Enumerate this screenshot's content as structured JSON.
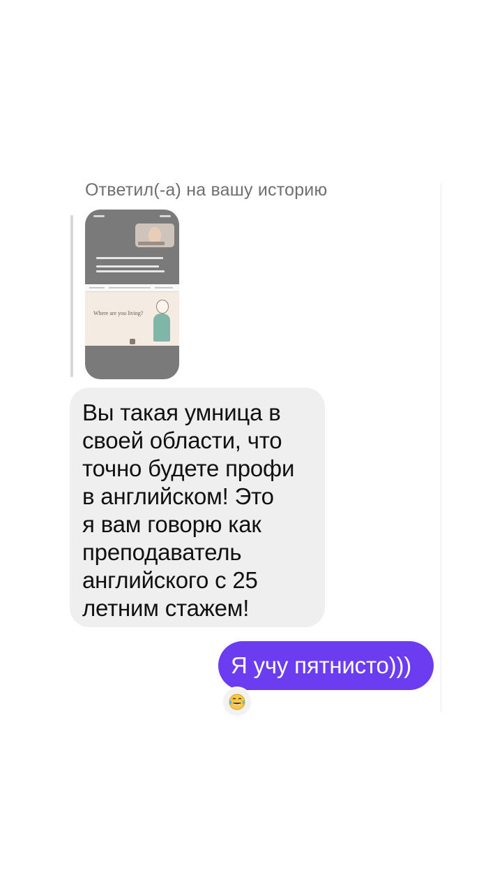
{
  "story_reply": {
    "header": "Ответил(-а) на вашу историю",
    "thumbnail": {
      "slide_text": "Where are you living?"
    }
  },
  "messages": [
    {
      "direction": "incoming",
      "text": "Вы такая умница в\nсвоей области, что\nточно будете профи\nв английском! Это\nя вам говорю как\nпреподаватель\nанглийского с 25\nлетним стажем!"
    },
    {
      "direction": "outgoing",
      "text": "Я учу пятнисто)))",
      "reaction": "face-with-tears-of-joy-icon"
    }
  ],
  "colors": {
    "outgoing_bubble": "#6c3cf0",
    "incoming_bubble": "#efefef",
    "story_header_text": "#6f6f6f"
  }
}
